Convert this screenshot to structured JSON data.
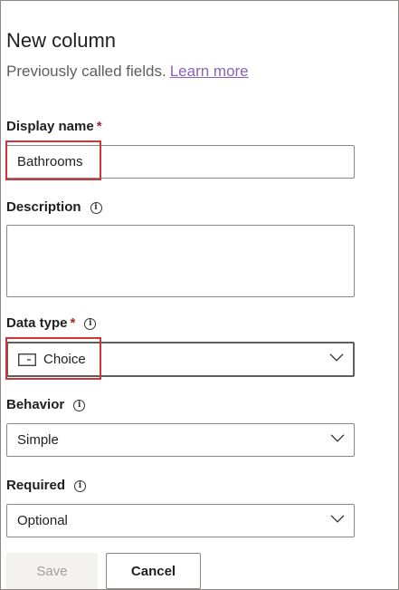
{
  "header": {
    "title": "New column",
    "subtitle": "Previously called fields.",
    "learn_more": "Learn more"
  },
  "display_name": {
    "label": "Display name",
    "required_mark": "*",
    "value": "Bathrooms"
  },
  "description": {
    "label": "Description",
    "value": ""
  },
  "data_type": {
    "label": "Data type",
    "required_mark": "*",
    "value": "Choice",
    "icon": "choice-icon"
  },
  "behavior": {
    "label": "Behavior",
    "value": "Simple"
  },
  "required": {
    "label": "Required",
    "value": "Optional"
  },
  "footer": {
    "save_label": "Save",
    "cancel_label": "Cancel"
  },
  "colors": {
    "highlight": "#d13438",
    "required_star": "#a4262c",
    "link": "#8764b8"
  }
}
